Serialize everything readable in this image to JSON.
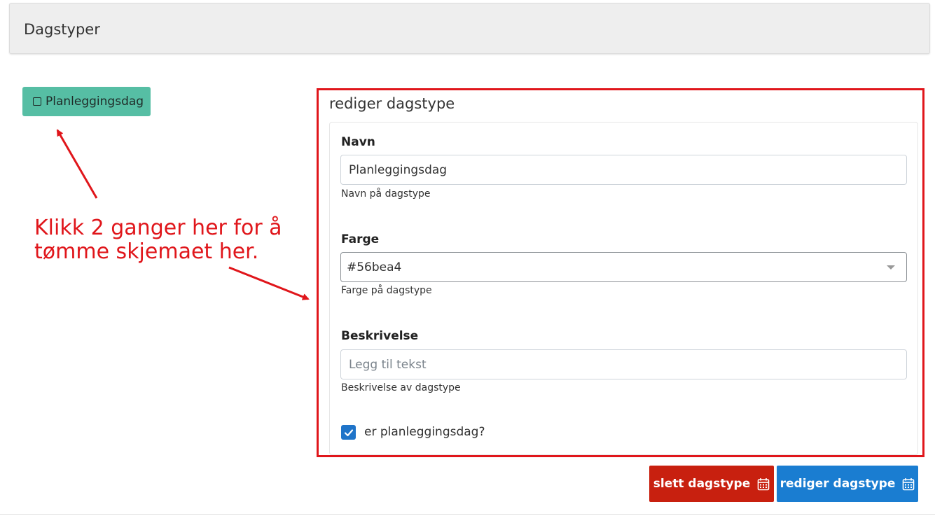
{
  "header": {
    "title": "Dagstyper"
  },
  "tag_button": {
    "label": "Planleggingsdag",
    "color": "#56bea4"
  },
  "panel": {
    "title": "rediger dagstype",
    "fields": {
      "navn": {
        "label": "Navn",
        "value": "Planleggingsdag",
        "help": "Navn på dagstype"
      },
      "farge": {
        "label": "Farge",
        "value": "#56bea4",
        "help": "Farge på dagstype"
      },
      "beskrivelse": {
        "label": "Beskrivelse",
        "placeholder": "Legg til tekst",
        "help": "Beskrivelse av dagstype"
      }
    },
    "checkbox": {
      "label": "er planleggingsdag?",
      "checked": true
    }
  },
  "buttons": {
    "delete": {
      "label": "slett dagstype",
      "icon": "calendar-icon",
      "color": "#c8200f"
    },
    "edit": {
      "label": "rediger dagstype",
      "icon": "calendar-icon",
      "color": "#1a7dd1"
    }
  },
  "annotation": {
    "line1": "Klikk 2 ganger her for å",
    "line2": "tømme skjemaet her.",
    "color": "#e0161b"
  }
}
